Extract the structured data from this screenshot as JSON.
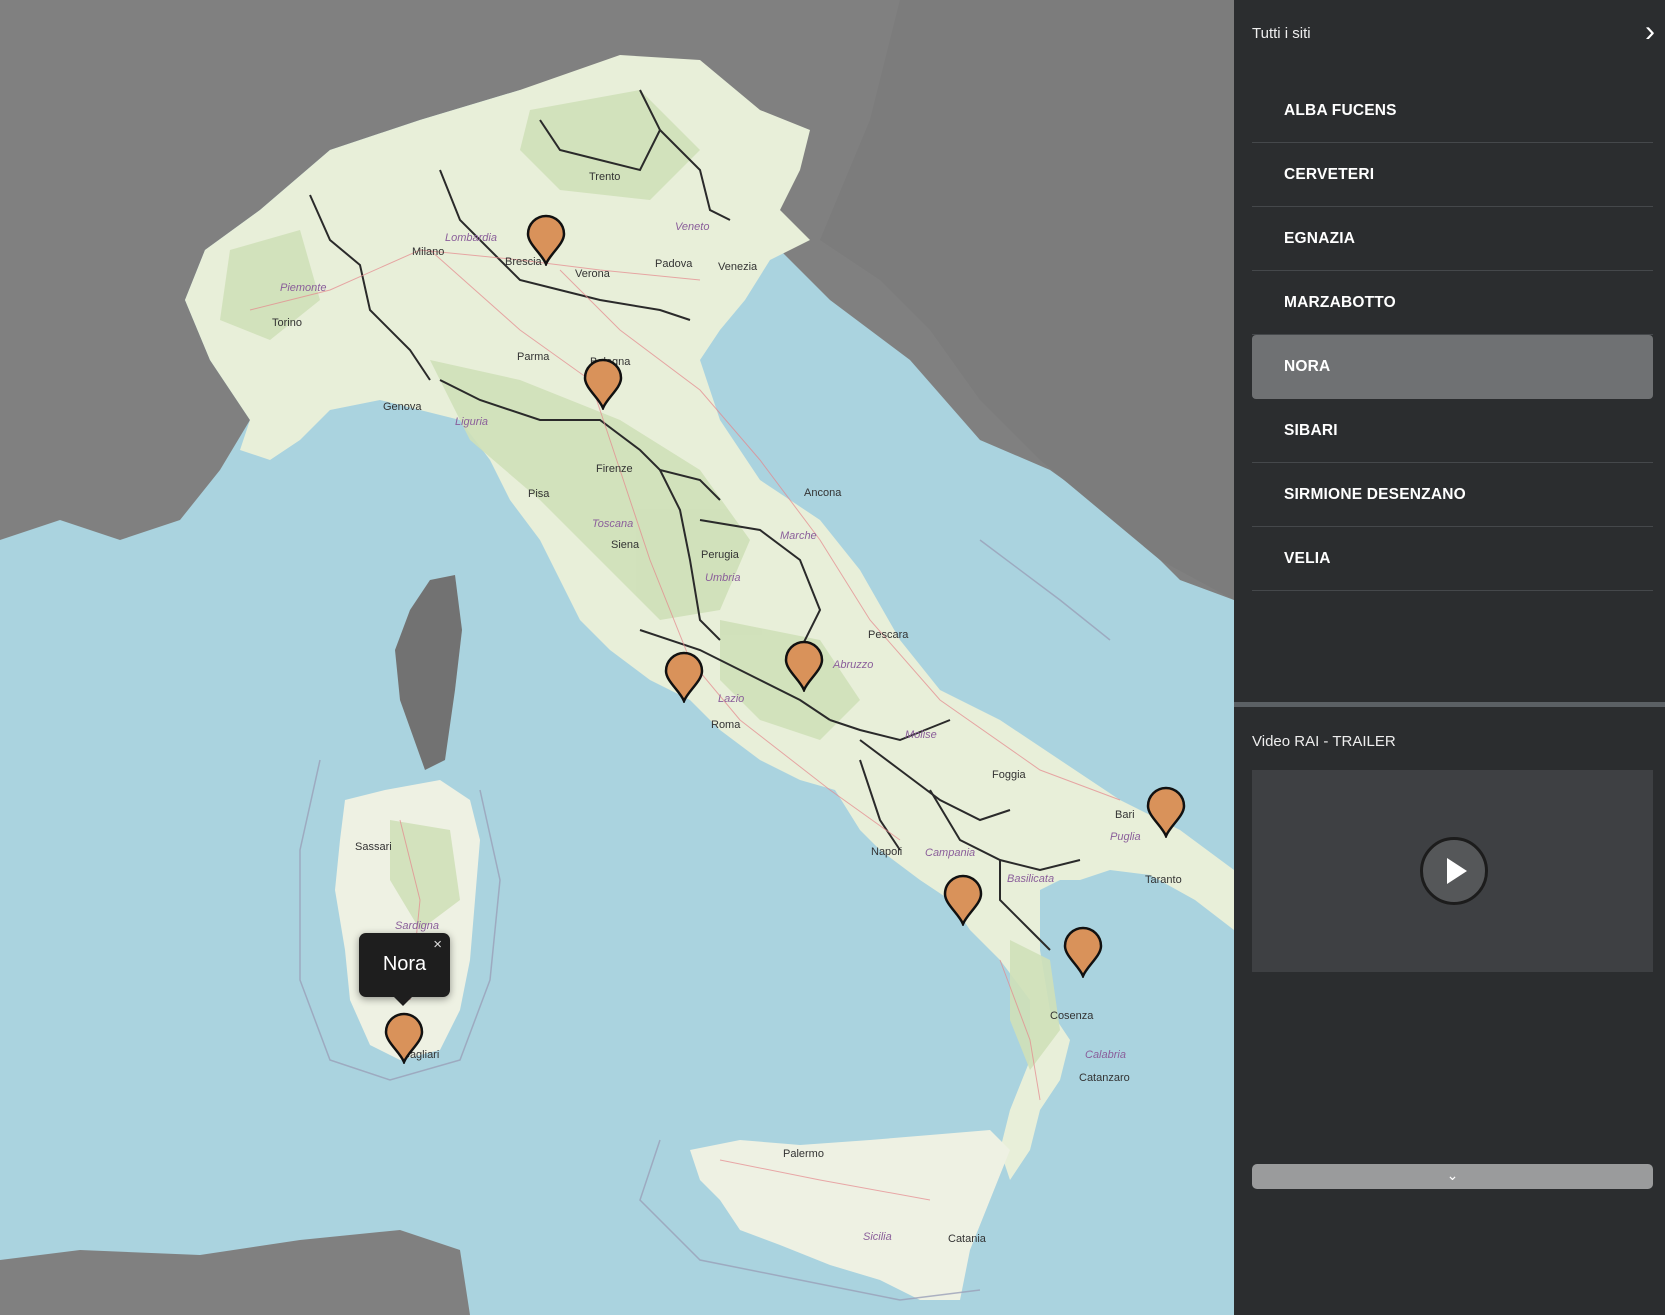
{
  "map": {
    "cities": [
      "Milano",
      "Torino",
      "Genova",
      "Verona",
      "Venezia",
      "Padova",
      "Firenze",
      "Roma",
      "Napoli",
      "Bari",
      "Palermo",
      "Cagliari",
      "Ancona",
      "Pescara",
      "Perugia",
      "Bologna",
      "Taranto",
      "Catanzaro",
      "Cosenza",
      "Pisa",
      "Siena",
      "Sassari",
      "Foggia",
      "Brescia",
      "Parma",
      "Trento",
      "Catania"
    ],
    "regions": [
      "Lombardia",
      "Piemonte",
      "Toscana",
      "Marche",
      "Umbria",
      "Lazio",
      "Abruzzo",
      "Molise",
      "Campania",
      "Puglia",
      "Basilicata",
      "Calabria",
      "Sardigna",
      "Sicilia",
      "Liguria",
      "Veneto"
    ],
    "markers": [
      "Sirmione Desenzano",
      "Marzabotto",
      "Cerveteri",
      "Alba Fucens",
      "Velia",
      "Sibari",
      "Egnazia",
      "Nora"
    ],
    "popup": {
      "text": "Nora",
      "close": "×"
    },
    "marker_color": "#D9925A"
  },
  "sidebar": {
    "sites_title": "Tutti i siti",
    "collapse_icon": "chevron-right-icon",
    "collapse_glyph": "›",
    "sites": [
      "ALBA FUCENS",
      "CERVETERI",
      "EGNAZIA",
      "MARZABOTTO",
      "NORA",
      "SIBARI",
      "SIRMIONE DESENZANO",
      "VELIA"
    ],
    "active_site": "NORA",
    "video_title": "Video RAI - TRAILER",
    "play_icon": "play-icon",
    "expand_icon": "chevron-down-icon",
    "expand_glyph": "⌄"
  },
  "colors": {
    "sea": "#AAD3DF",
    "land": "#F2EFE9",
    "foreign": "#808080",
    "sidebar_bg": "#2B2D2F",
    "active_item": "#6F7173"
  }
}
